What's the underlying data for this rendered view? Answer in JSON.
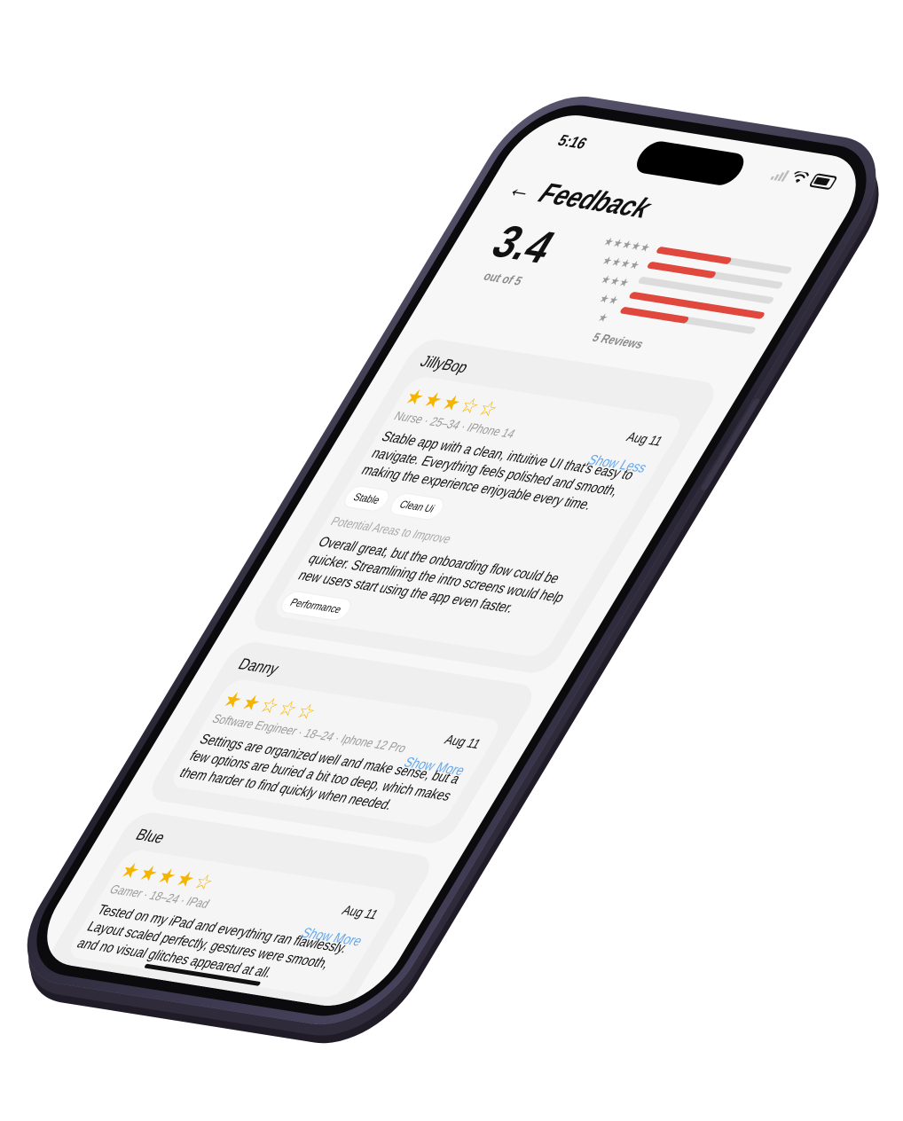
{
  "status": {
    "time": "5:16"
  },
  "header": {
    "title": "Feedback"
  },
  "summary": {
    "average": "3.4",
    "out_of": "out of 5",
    "reviews_label": "5 Reviews",
    "distribution": [
      {
        "stars": "★★★★★",
        "fraction": 0.55
      },
      {
        "stars": "★★★★",
        "fraction": 0.5
      },
      {
        "stars": "★★★",
        "fraction": 0.0
      },
      {
        "stars": "★★",
        "fraction": 1.0
      },
      {
        "stars": "★",
        "fraction": 0.5
      }
    ]
  },
  "reviews": [
    {
      "name": "JillyBop",
      "rating": 3,
      "meta": "Nurse · 25–34 · IPhone 14",
      "date": "Aug 11",
      "toggle": "Show Less",
      "body": "Stable app with a clean, intuitive UI that's easy to navigate. Everything feels polished and smooth, making the experience enjoyable every time.",
      "tags": [
        "Stable",
        "Clean Ui"
      ],
      "improve_title": "Potential Areas to Improve",
      "improve_body": "Overall great, but the onboarding flow could be quicker. Streamlining the intro screens would help new users start using the app even faster.",
      "improve_tags": [
        "Performance"
      ]
    },
    {
      "name": "Danny",
      "rating": 2,
      "meta": "Software Engineer · 18–24 · Iphone 12 Pro",
      "date": "Aug 11",
      "toggle": "Show More",
      "body": "Settings are organized well and make sense, but a few options are buried a bit too deep, which makes them harder to find quickly when needed."
    },
    {
      "name": "Blue",
      "rating": 4,
      "meta": "Gamer · 18–24 · IPad",
      "date": "Aug 11",
      "toggle": "Show More",
      "body": "Tested on my iPad and everything ran flawlessly. Layout scaled perfectly, gestures were smooth, and no visual glitches appeared at all."
    }
  ],
  "colors": {
    "accent": "#66a8ee",
    "bar": "#e0473d",
    "star": "#f5b400"
  }
}
